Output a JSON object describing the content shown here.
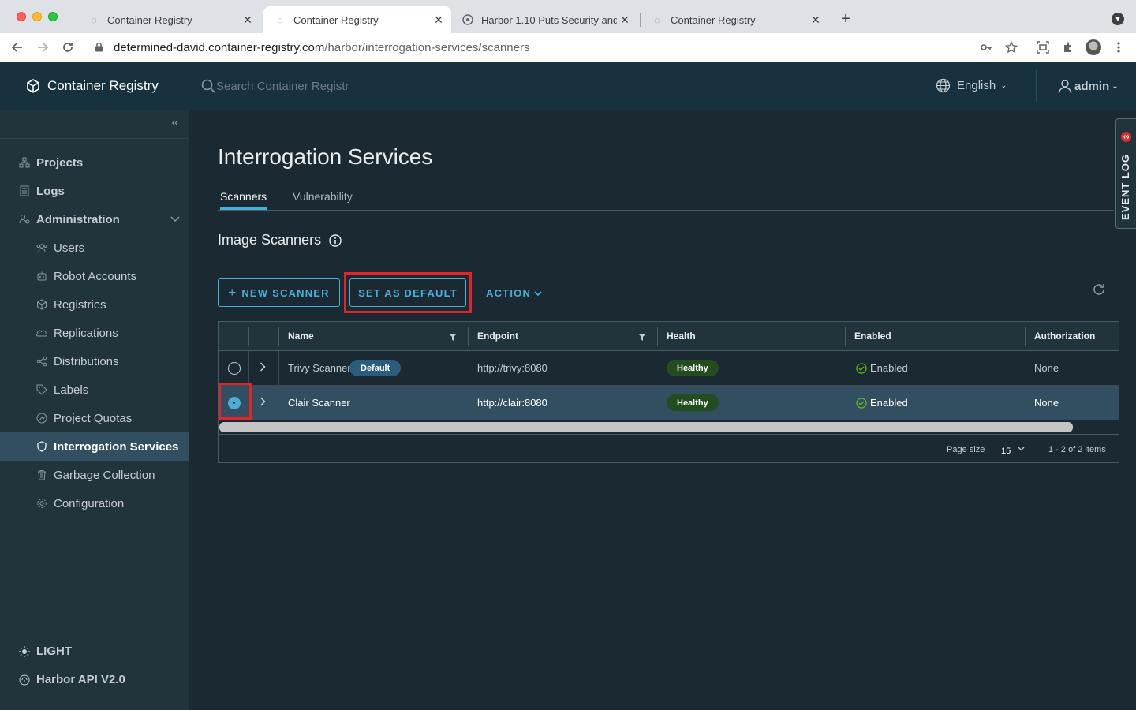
{
  "browser": {
    "tabs": [
      {
        "title": "Container Registry"
      },
      {
        "title": "Container Registry"
      },
      {
        "title": "Harbor 1.10 Puts Security and I"
      },
      {
        "title": "Container Registry"
      }
    ],
    "url_host": "determined-david.container-registry.com",
    "url_path": "/harbor/interrogation-services/scanners"
  },
  "header": {
    "brand": "Container Registry",
    "search_placeholder": "Search Container Registr",
    "language": "English",
    "user": "admin"
  },
  "sidebar": {
    "items": [
      {
        "label": "Projects",
        "icon": "projects-icon"
      },
      {
        "label": "Logs",
        "icon": "logs-icon"
      },
      {
        "label": "Administration",
        "icon": "administration-icon"
      }
    ],
    "admin_items": [
      {
        "label": "Users",
        "icon": "users-icon"
      },
      {
        "label": "Robot Accounts",
        "icon": "robot-icon"
      },
      {
        "label": "Registries",
        "icon": "registries-icon"
      },
      {
        "label": "Replications",
        "icon": "replications-icon"
      },
      {
        "label": "Distributions",
        "icon": "distributions-icon"
      },
      {
        "label": "Labels",
        "icon": "labels-icon"
      },
      {
        "label": "Project Quotas",
        "icon": "quotas-icon"
      },
      {
        "label": "Interrogation Services",
        "icon": "shield-icon"
      },
      {
        "label": "Garbage Collection",
        "icon": "trash-icon"
      },
      {
        "label": "Configuration",
        "icon": "gear-icon"
      }
    ],
    "theme_toggle": "LIGHT",
    "api_link": "Harbor API V2.0"
  },
  "main": {
    "title": "Interrogation Services",
    "tabs": [
      {
        "label": "Scanners",
        "active": true
      },
      {
        "label": "Vulnerability",
        "active": false
      }
    ],
    "section_title": "Image Scanners",
    "actions": {
      "new_scanner": "NEW SCANNER",
      "set_default": "SET AS DEFAULT",
      "action": "ACTION"
    },
    "grid": {
      "columns": [
        "Name",
        "Endpoint",
        "Health",
        "Enabled",
        "Authorization"
      ],
      "rows": [
        {
          "name": "Trivy Scanner",
          "default_badge": "Default",
          "endpoint": "http://trivy:8080",
          "health": "Healthy",
          "enabled": "Enabled",
          "authorization": "None",
          "selected": false
        },
        {
          "name": "Clair Scanner",
          "endpoint": "http://clair:8080",
          "health": "Healthy",
          "enabled": "Enabled",
          "authorization": "None",
          "selected": true
        }
      ],
      "page_size_label": "Page size",
      "page_size": "15",
      "count_text": "1 - 2 of 2 items"
    }
  },
  "event_log": {
    "label": "EVENT LOG",
    "count": "3"
  },
  "colors": {
    "accent": "#49afd9",
    "header_bg": "#17313e",
    "sidebar_bg": "#21333b",
    "highlight": "#e0252b",
    "healthy": "#234d1e"
  }
}
